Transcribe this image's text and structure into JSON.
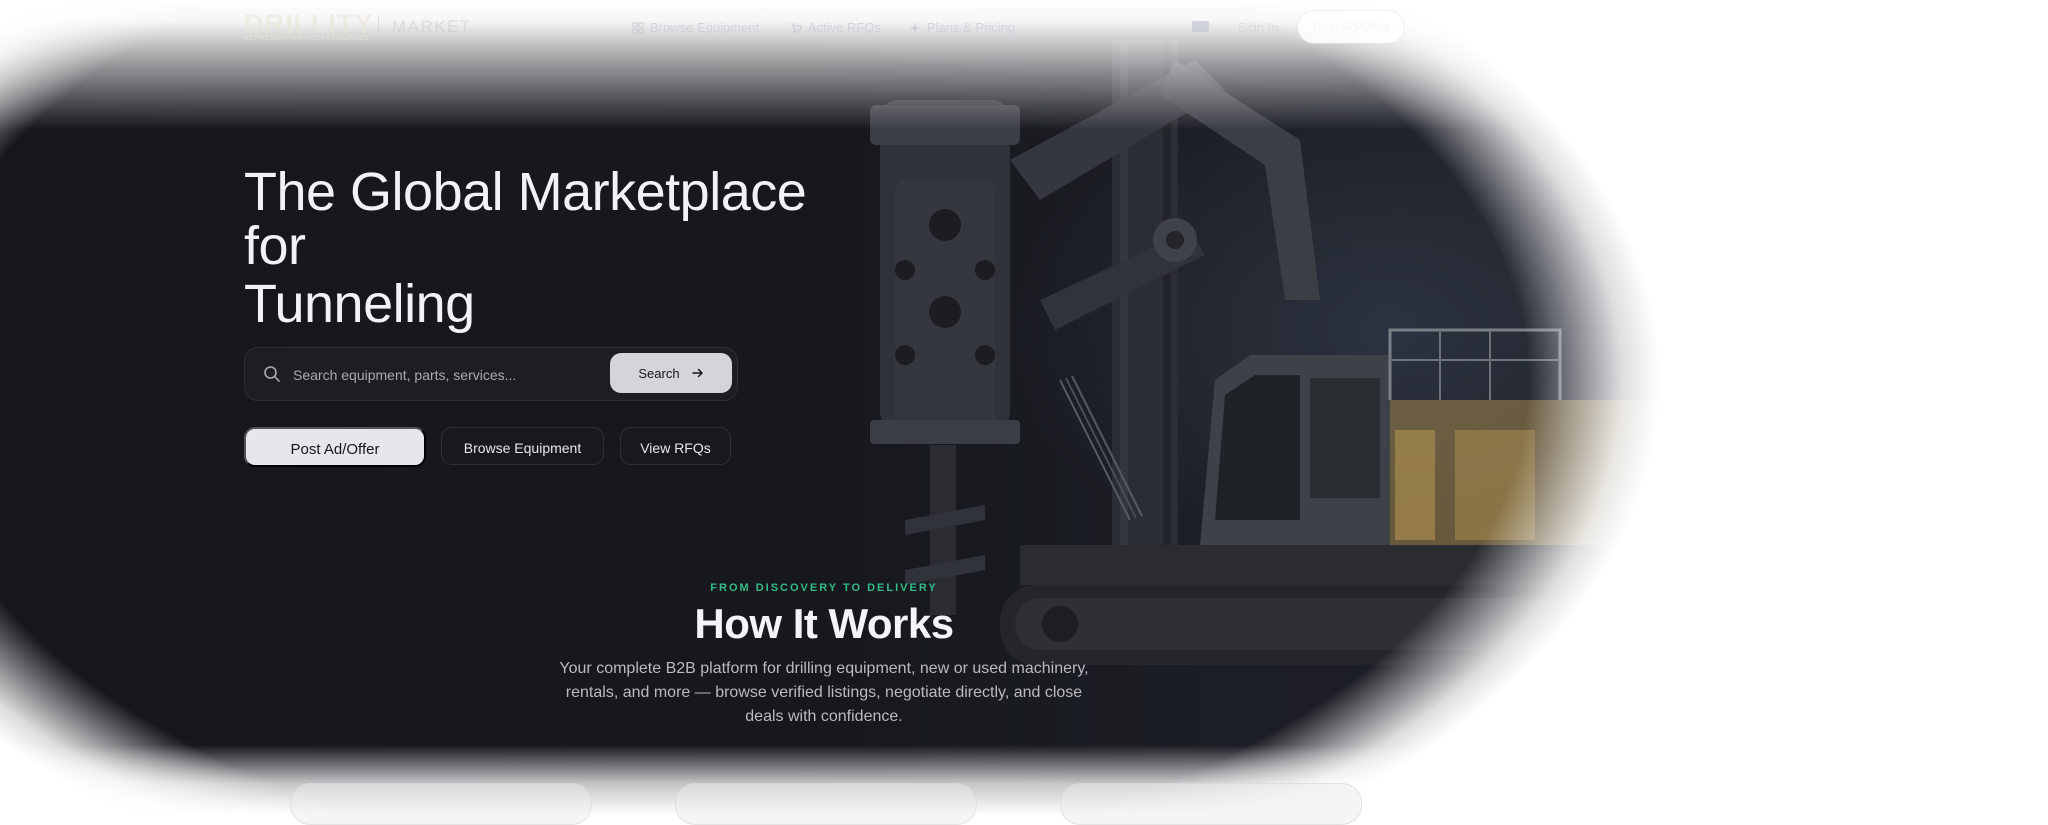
{
  "nav": {
    "logo_main": "DRILLITY",
    "logo_sub": "REPRESENTING PROFESSIONALS",
    "logo_market": "MARKET",
    "links": [
      {
        "label": "Browse Equipment",
        "icon": "grid-icon"
      },
      {
        "label": "Active RFQs",
        "icon": "cart-icon"
      },
      {
        "label": "Plans & Pricing",
        "icon": "sparkle-icon"
      }
    ],
    "language_icon": "uk-flag-icon",
    "signin": "Sign In",
    "cta": "Post Ad/Offer"
  },
  "hero": {
    "headline_line1": "The Global Marketplace",
    "headline_line2": "for",
    "headline_line3": "Tunneling",
    "search_placeholder": "Search equipment, parts, services...",
    "search_button": "Search",
    "primary_button": "Post Ad/Offer",
    "browse_button": "Browse Equipment",
    "rfq_button": "View RFQs"
  },
  "how_it_works": {
    "eyebrow": "FROM DISCOVERY TO DELIVERY",
    "title": "How It Works",
    "description": "Your complete B2B platform for drilling equipment, new or used machinery, rentals, and more — browse verified listings, negotiate directly, and close deals with confidence."
  },
  "colors": {
    "hero_bg": "#15171c",
    "accent_green": "#35b985",
    "machine_yellow": "#d8b25a"
  }
}
